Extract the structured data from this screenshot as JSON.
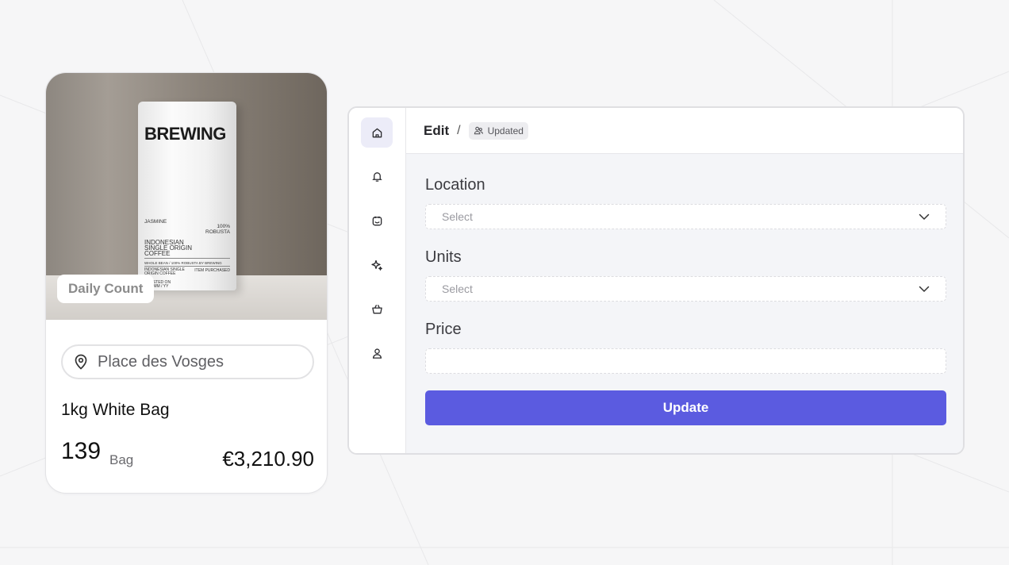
{
  "product_card": {
    "badge": "Daily Count",
    "location": "Place des Vosges",
    "name": "1kg White Bag",
    "quantity": "139",
    "unit": "Bag",
    "price": "€3,210.90",
    "bag_print": {
      "brand": "BREWING",
      "variety": "JASMINE",
      "robusta_line1": "100%",
      "robusta_line2": "ROBUSTA",
      "origin": "INDONESIAN\nSINGLE ORIGIN\nCOFFEE",
      "bean_line": "WHOLE BEAN / 100% ROBUSTA BY BREWING",
      "origin_small": "INDONESIAN SINGLE\nORIGIN COFFEE",
      "purchased": "ITEM PURCHASED",
      "roasted": "ROASTED ON\nDD / MM / YY",
      "description": "AUTHENTIC INDONESIAN FLAVOR FROM\nTHE ISLAND OF JAVA, LOW ACIDITY WITH\nEARTHY FLAVOR AND A NOTE OF CARAMEL",
      "weight": "NET WEIGHT 35Oz / 1KG"
    }
  },
  "panel": {
    "sidebar": [
      {
        "name": "home-icon",
        "active": true
      },
      {
        "name": "bell-icon",
        "active": false
      },
      {
        "name": "calendar-icon",
        "active": false
      },
      {
        "name": "sparkle-icon",
        "active": false
      },
      {
        "name": "basket-icon",
        "active": false
      },
      {
        "name": "user-icon",
        "active": false
      }
    ],
    "breadcrumb": {
      "title": "Edit",
      "separator": "/",
      "status": "Updated"
    },
    "form": {
      "location_label": "Location",
      "location_value": "Select",
      "units_label": "Units",
      "units_value": "Select",
      "price_label": "Price",
      "price_value": "",
      "submit_label": "Update"
    },
    "colors": {
      "accent": "#5b5be0",
      "active_nav_bg": "#ececf8"
    }
  }
}
